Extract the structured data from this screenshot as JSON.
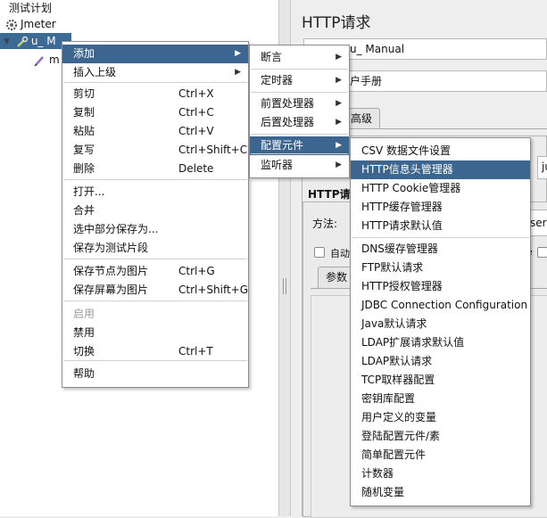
{
  "tree": {
    "items": [
      {
        "label": "测试计划"
      },
      {
        "label": "Jmeter"
      },
      {
        "label": "u_ M"
      },
      {
        "label": "m"
      }
    ]
  },
  "right": {
    "title": "HTTP请求",
    "name_value": "u_ Manual",
    "comment_value": "户手册",
    "tab_advanced": "高级",
    "dropdown_value": "ju",
    "section_label": "HTTP请求",
    "method_label": "方法:",
    "method_value": "serr",
    "auto_redirect_label": "自动",
    "checkbox_tail": "e",
    "params_tab": "参数"
  },
  "context_menu": {
    "items": [
      {
        "label": "添加",
        "shortcut": "",
        "submenu": true
      },
      {
        "label": "插入上级",
        "shortcut": "",
        "submenu": true
      },
      {
        "label": "剪切",
        "shortcut": "Ctrl+X"
      },
      {
        "label": "复制",
        "shortcut": "Ctrl+C"
      },
      {
        "label": "粘贴",
        "shortcut": "Ctrl+V"
      },
      {
        "label": "复写",
        "shortcut": "Ctrl+Shift+C"
      },
      {
        "label": "删除",
        "shortcut": "Delete"
      },
      {
        "label": "打开...",
        "shortcut": ""
      },
      {
        "label": "合并",
        "shortcut": ""
      },
      {
        "label": "选中部分保存为...",
        "shortcut": ""
      },
      {
        "label": "保存为测试片段",
        "shortcut": ""
      },
      {
        "label": "保存节点为图片",
        "shortcut": "Ctrl+G"
      },
      {
        "label": "保存屏幕为图片",
        "shortcut": "Ctrl+Shift+G"
      },
      {
        "label": "启用",
        "shortcut": ""
      },
      {
        "label": "禁用",
        "shortcut": ""
      },
      {
        "label": "切换",
        "shortcut": "Ctrl+T"
      },
      {
        "label": "帮助",
        "shortcut": ""
      }
    ]
  },
  "add_submenu": {
    "items": [
      {
        "label": "断言"
      },
      {
        "label": "定时器"
      },
      {
        "label": "前置处理器"
      },
      {
        "label": "后置处理器"
      },
      {
        "label": "配置元件"
      },
      {
        "label": "监听器"
      }
    ]
  },
  "config_submenu": {
    "items": [
      {
        "label": "CSV 数据文件设置"
      },
      {
        "label": "HTTP信息头管理器"
      },
      {
        "label": "HTTP Cookie管理器"
      },
      {
        "label": "HTTP缓存管理器"
      },
      {
        "label": "HTTP请求默认值"
      },
      {
        "label": "DNS缓存管理器"
      },
      {
        "label": "FTP默认请求"
      },
      {
        "label": "HTTP授权管理器"
      },
      {
        "label": "JDBC Connection Configuration"
      },
      {
        "label": "Java默认请求"
      },
      {
        "label": "LDAP扩展请求默认值"
      },
      {
        "label": "LDAP默认请求"
      },
      {
        "label": "TCP取样器配置"
      },
      {
        "label": "密钥库配置"
      },
      {
        "label": "用户定义的变量"
      },
      {
        "label": "登陆配置元件/素"
      },
      {
        "label": "简单配置元件"
      },
      {
        "label": "计数器"
      },
      {
        "label": "随机变量"
      }
    ]
  },
  "colors": {
    "highlight": "#3c6690",
    "tree_selection": "#3d6a94"
  }
}
